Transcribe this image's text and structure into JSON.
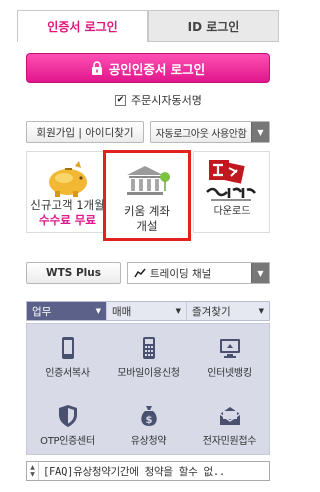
{
  "tabs": {
    "cert_login": "인증서 로그인",
    "id_login": "ID 로그인"
  },
  "cert_button": {
    "label": "공인인증서 로그인",
    "icon": "lock-icon"
  },
  "order_signature": {
    "label": "주문시자동서명",
    "checked": true
  },
  "links": {
    "join_find_id": "회원가입 | 아이디찾기",
    "auto_logout": "자동로그아웃 사용안함"
  },
  "promos": {
    "new_customer": {
      "line1": "신규고객 1개월",
      "line2": "수수료 무료",
      "icon": "piggy-bank-icon"
    },
    "open_account": {
      "line1": "키움 계좌",
      "line2": "개설",
      "icon": "bank-building-icon"
    },
    "younghero": {
      "label": "다운로드",
      "icon": "younghero-logo"
    }
  },
  "wts": {
    "label": "WTS Plus"
  },
  "trading_channel": {
    "label": "트레이딩 채널",
    "icon": "trend-line-icon"
  },
  "menu_tabs": [
    {
      "label": "업무",
      "active": true
    },
    {
      "label": "매매",
      "active": false
    },
    {
      "label": "즐겨찾기",
      "active": false
    }
  ],
  "services": [
    {
      "label": "인증서복사",
      "icon": "phone-icon"
    },
    {
      "label": "모바일이용신청",
      "icon": "calculator-phone-icon"
    },
    {
      "label": "인터넷뱅킹",
      "icon": "monitor-icon"
    },
    {
      "label": "OTP인증센터",
      "icon": "shield-icon"
    },
    {
      "label": "유상청약",
      "icon": "money-bag-icon"
    },
    {
      "label": "전자민원접수",
      "icon": "mail-icon"
    }
  ],
  "faq": {
    "text": "[FAQ]유상청약기간에 청약을 할수 없.."
  },
  "colors": {
    "pink": "#e0168c",
    "highlight_red": "#e0231c",
    "menu_active": "#5b6189"
  }
}
